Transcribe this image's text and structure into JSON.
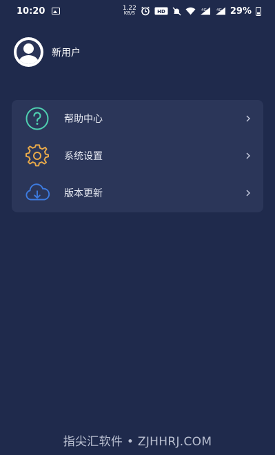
{
  "status_bar": {
    "time": "10:20",
    "net_speed_value": "1.22",
    "net_speed_unit": "KB/S",
    "volte": "VoLTE",
    "signal1_label": "4G",
    "signal2_label": "4G",
    "battery": "29%"
  },
  "user": {
    "name": "新用户"
  },
  "menu": {
    "items": [
      {
        "label": "帮助中心",
        "icon": "question-circle-icon",
        "color": "#4fd1b1"
      },
      {
        "label": "系统设置",
        "icon": "gear-icon",
        "color": "#e8a94a"
      },
      {
        "label": "版本更新",
        "icon": "cloud-download-icon",
        "color": "#3d7be0"
      }
    ]
  },
  "watermark": "指尖汇软件 • ZJHHRJ.COM",
  "colors": {
    "background": "#1f2a4c",
    "card": "#2b3659"
  }
}
